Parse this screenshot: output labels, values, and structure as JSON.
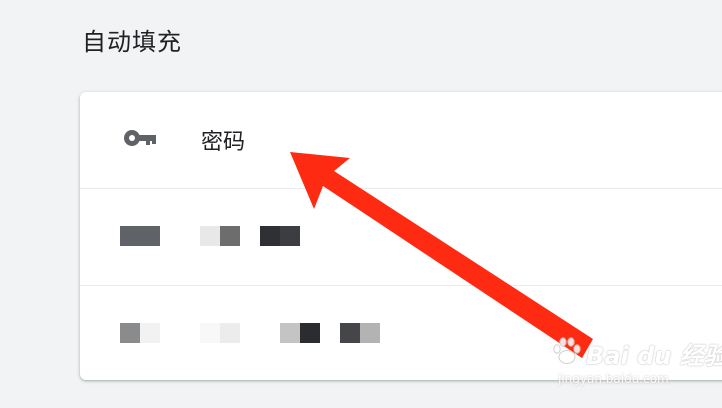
{
  "section": {
    "title": "自动填充"
  },
  "rows": [
    {
      "label": "密码",
      "icon": "key-icon"
    }
  ],
  "watermark": {
    "main": "Bai du 经验",
    "sub": "jingyan.baidu.com"
  },
  "colors": {
    "page_background": "#f1f3f4",
    "card_background": "#ffffff",
    "annotation_arrow": "#ff2a12"
  }
}
